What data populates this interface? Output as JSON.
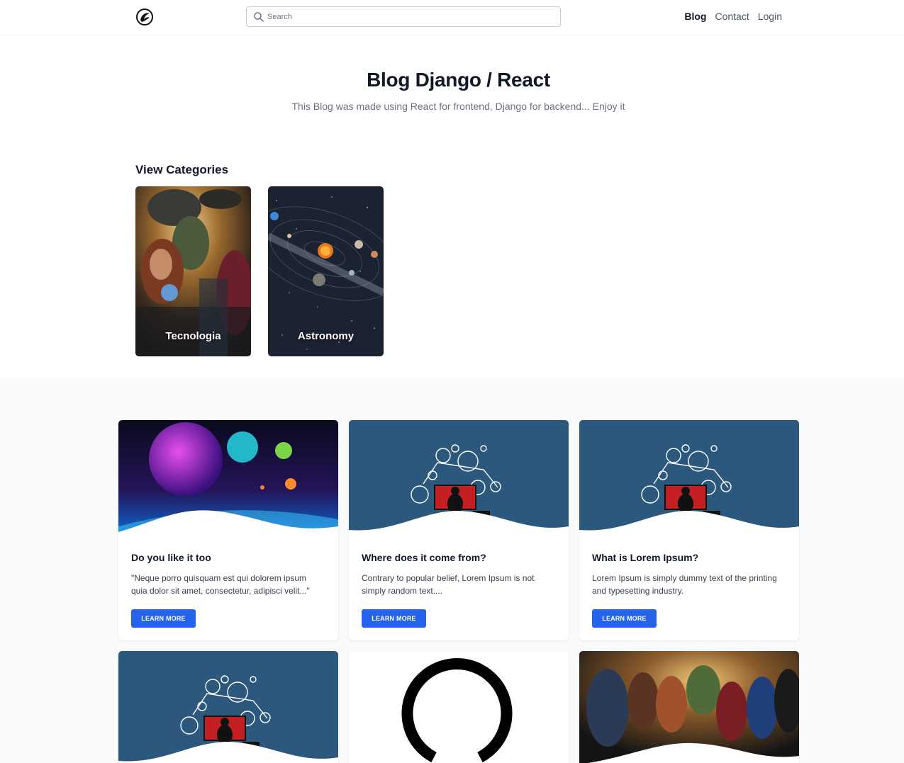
{
  "nav": {
    "search_placeholder": "Search",
    "links": [
      "Blog",
      "Contact",
      "Login"
    ]
  },
  "hero": {
    "title": "Blog Django / React",
    "subtitle": "This Blog was made using React for frontend, Django for backend... Enjoy it"
  },
  "categories": {
    "heading": "View Categories",
    "items": [
      {
        "label": "Tecnologia"
      },
      {
        "label": "Astronomy"
      }
    ]
  },
  "posts": [
    {
      "title": "Do you like it too",
      "excerpt": "\"Neque porro quisquam est qui dolorem ipsum quia dolor sit amet, consectetur, adipisci velit...\"",
      "button": "LEARN MORE"
    },
    {
      "title": "Where does it come from?",
      "excerpt": "Contrary to popular belief, Lorem Ipsum is not simply random text....",
      "button": "LEARN MORE"
    },
    {
      "title": "What is Lorem Ipsum?",
      "excerpt": "Lorem Ipsum is simply dummy text of the printing and typesetting industry.",
      "button": "LEARN MORE"
    }
  ],
  "colors": {
    "accent": "#2563eb",
    "thumb_blue": "#2b587c",
    "text_dark": "#111827",
    "text_muted": "#6b7280"
  }
}
